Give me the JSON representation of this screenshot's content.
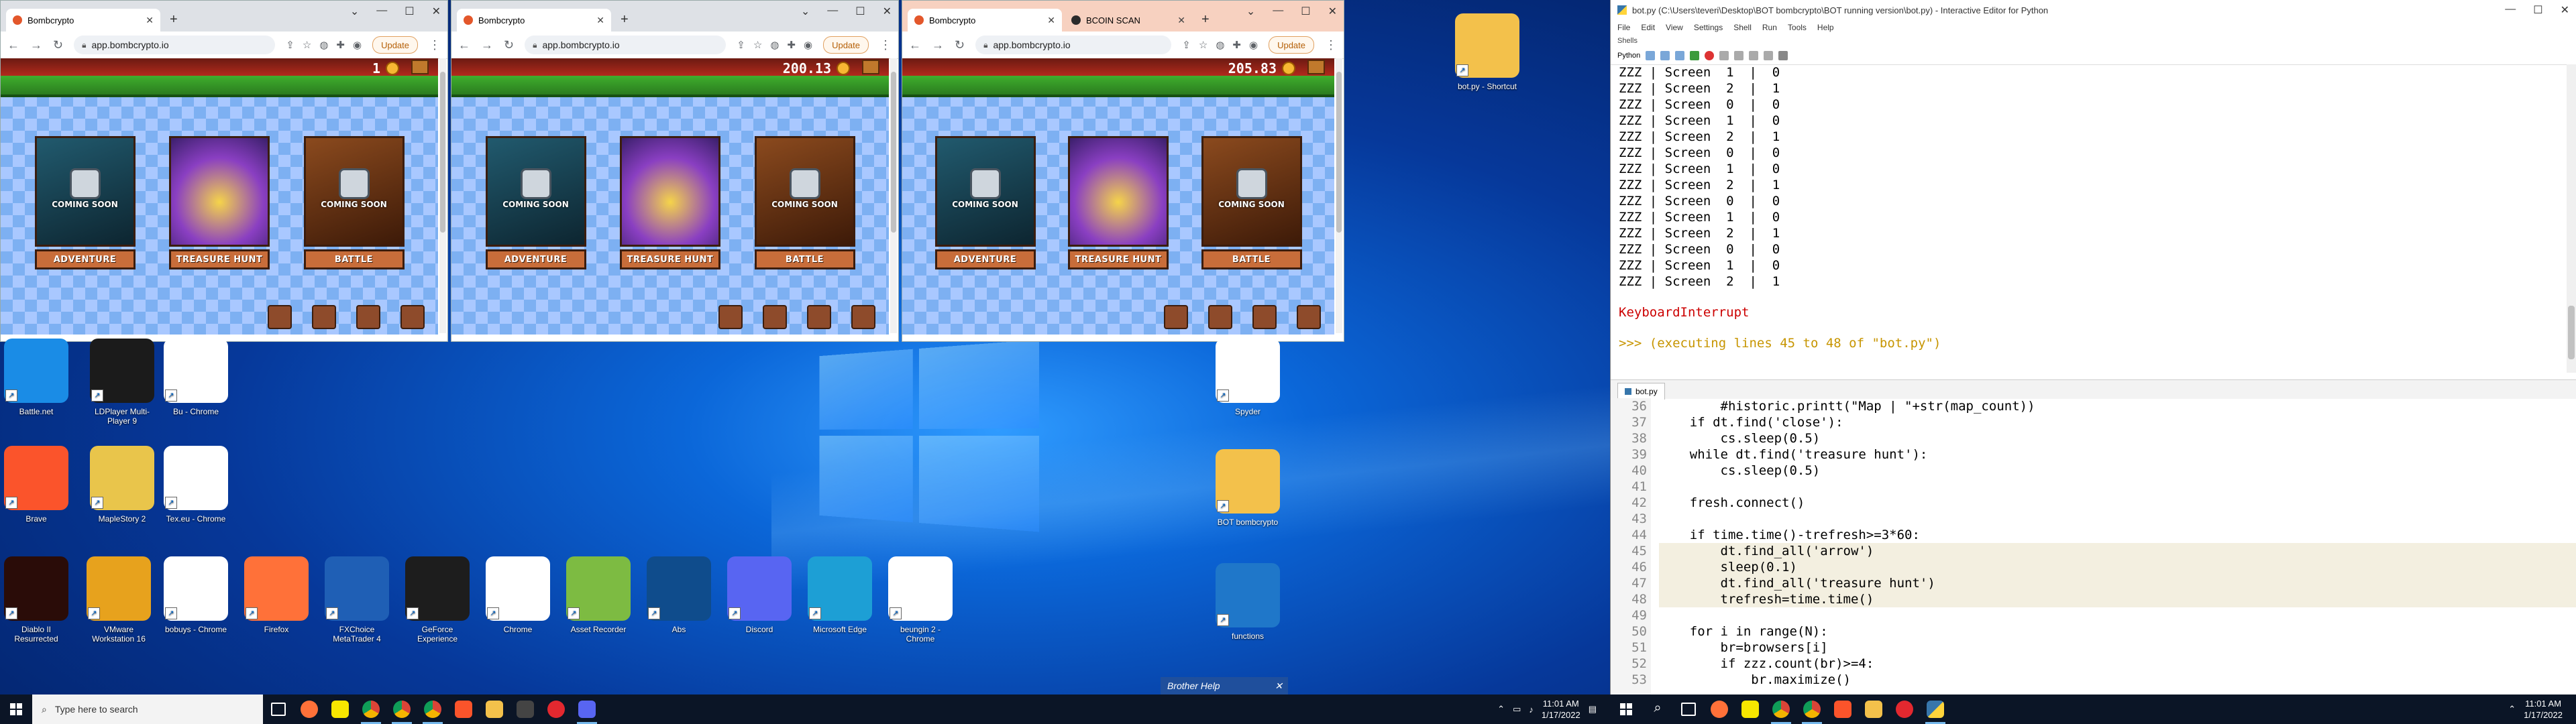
{
  "browsers": [
    {
      "tabs": [
        {
          "title": "Bombcrypto"
        }
      ],
      "url": "app.bombcrypto.io",
      "update_label": "Update",
      "coins": "1",
      "cards": [
        {
          "label": "ADVENTURE",
          "overlay": "COMING SOON"
        },
        {
          "label": "TREASURE HUNT",
          "overlay": ""
        },
        {
          "label": "BATTLE",
          "overlay": "COMING SOON"
        }
      ]
    },
    {
      "tabs": [
        {
          "title": "Bombcrypto"
        }
      ],
      "url": "app.bombcrypto.io",
      "update_label": "Update",
      "coins": "200.13",
      "cards": [
        {
          "label": "ADVENTURE",
          "overlay": "COMING SOON"
        },
        {
          "label": "TREASURE HUNT",
          "overlay": ""
        },
        {
          "label": "BATTLE",
          "overlay": "COMING SOON"
        }
      ]
    },
    {
      "tabs": [
        {
          "title": "Bombcrypto"
        },
        {
          "title": "BCOIN SCAN"
        }
      ],
      "url": "app.bombcrypto.io",
      "update_label": "Update",
      "coins": "205.83",
      "cards": [
        {
          "label": "ADVENTURE",
          "overlay": "COMING SOON"
        },
        {
          "label": "TREASURE HUNT",
          "overlay": ""
        },
        {
          "label": "BATTLE",
          "overlay": "COMING SOON"
        }
      ]
    }
  ],
  "desktop_icons": [
    {
      "label": "Battle.net",
      "icon": "battlenet-icon",
      "color": "#1a8ce6"
    },
    {
      "label": "LDPlayer Multi-Player 9",
      "icon": "ldplayer-icon",
      "color": "#1b1b1b"
    },
    {
      "label": "Bu - Chrome",
      "icon": "chrome-icon",
      "color": "#ffffff"
    },
    {
      "label": "Brave",
      "icon": "brave-icon",
      "color": "#fb542b"
    },
    {
      "label": "MapleStory 2",
      "icon": "maplestory-icon",
      "color": "#e9c54b"
    },
    {
      "label": "Tex.eu - Chrome",
      "icon": "chrome-icon",
      "color": "#ffffff"
    },
    {
      "label": "Diablo II Resurrected",
      "icon": "diablo-icon",
      "color": "#2a0c08"
    },
    {
      "label": "VMware Workstation 16 Player",
      "icon": "vmware-icon",
      "color": "#e7a21d"
    },
    {
      "label": "bobuys - Chrome",
      "icon": "chrome-icon",
      "color": "#ffffff"
    },
    {
      "label": "Firefox",
      "icon": "firefox-icon",
      "color": "#ff7139"
    },
    {
      "label": "FXChoice MetaTrader 4",
      "icon": "metatrader-icon",
      "color": "#1f5fb5"
    },
    {
      "label": "GeForce Experience",
      "icon": "geforce-icon",
      "color": "#1d1d1d"
    },
    {
      "label": "Chrome",
      "icon": "chrome-icon",
      "color": "#ffffff"
    },
    {
      "label": "Asset Recorder",
      "icon": "recorder-icon",
      "color": "#7dbb42"
    },
    {
      "label": "Abs",
      "icon": "abs-icon",
      "color": "#0f4c8c"
    },
    {
      "label": "Discord",
      "icon": "discord-icon",
      "color": "#5865f2"
    },
    {
      "label": "Microsoft Edge",
      "icon": "edge-icon",
      "color": "#1d9fd5"
    },
    {
      "label": "beungin 2 - Chrome",
      "icon": "chrome-icon",
      "color": "#ffffff"
    },
    {
      "label": "Spyder",
      "icon": "spyder-icon",
      "color": "#ffffff"
    },
    {
      "label": "BOT bombcrypto",
      "icon": "folder-icon",
      "color": "#f3c14b"
    },
    {
      "label": "functions",
      "icon": "functions-icon",
      "color": "#1f77c9"
    },
    {
      "label": "bot.py - Shortcut",
      "icon": "folder-icon",
      "color": "#f3c14b"
    }
  ],
  "brother_help": "Brother Help",
  "taskbar1": {
    "search_placeholder": "Type here to search",
    "time": "11:01 AM",
    "date": "1/17/2022"
  },
  "taskbar2": {
    "time": "11:01 AM",
    "date": "1/17/2022"
  },
  "idle": {
    "title": "bot.py (C:\\Users\\teveri\\Desktop\\BOT bombcrypto\\BOT running version\\bot.py) - Interactive Editor for Python",
    "menu": [
      "File",
      "Edit",
      "View",
      "Settings",
      "Shell",
      "Run",
      "Tools",
      "Help"
    ],
    "shells_label": "Shells",
    "python_label": "Python",
    "shell_lines": [
      "ZZZ | Screen  1  |  0",
      "ZZZ | Screen  2  |  1",
      "ZZZ | Screen  0  |  0",
      "ZZZ | Screen  1  |  0",
      "ZZZ | Screen  2  |  1",
      "ZZZ | Screen  0  |  0",
      "ZZZ | Screen  1  |  0",
      "ZZZ | Screen  2  |  1",
      "ZZZ | Screen  0  |  0",
      "ZZZ | Screen  1  |  0",
      "ZZZ | Screen  2  |  1",
      "ZZZ | Screen  0  |  0",
      "ZZZ | Screen  1  |  0",
      "ZZZ | Screen  2  |  1"
    ],
    "shell_error": "KeyboardInterrupt",
    "shell_exec": ">>> (executing lines 45 to 48 of \"bot.py\")",
    "editor_tab": "bot.py",
    "code_lines": [
      {
        "n": "36",
        "t": "        #historic.printt(\"Map | \"+str(map_count))"
      },
      {
        "n": "37",
        "t": "    if dt.find('close'):"
      },
      {
        "n": "38",
        "t": "        cs.sleep(0.5)"
      },
      {
        "n": "39",
        "t": "    while dt.find('treasure hunt'):"
      },
      {
        "n": "40",
        "t": "        cs.sleep(0.5)"
      },
      {
        "n": "41",
        "t": ""
      },
      {
        "n": "42",
        "t": "    fresh.connect()"
      },
      {
        "n": "43",
        "t": ""
      },
      {
        "n": "44",
        "t": "    if time.time()-trefresh>=3*60:"
      },
      {
        "n": "45",
        "t": "        dt.find_all('arrow')"
      },
      {
        "n": "46",
        "t": "        sleep(0.1)"
      },
      {
        "n": "47",
        "t": "        dt.find_all('treasure hunt')"
      },
      {
        "n": "48",
        "t": "        trefresh=time.time()"
      },
      {
        "n": "49",
        "t": ""
      },
      {
        "n": "50",
        "t": "    for i in range(N):"
      },
      {
        "n": "51",
        "t": "        br=browsers[i]"
      },
      {
        "n": "52",
        "t": "        if zzz.count(br)>=4:"
      },
      {
        "n": "53",
        "t": "            br.maximize()"
      }
    ]
  }
}
